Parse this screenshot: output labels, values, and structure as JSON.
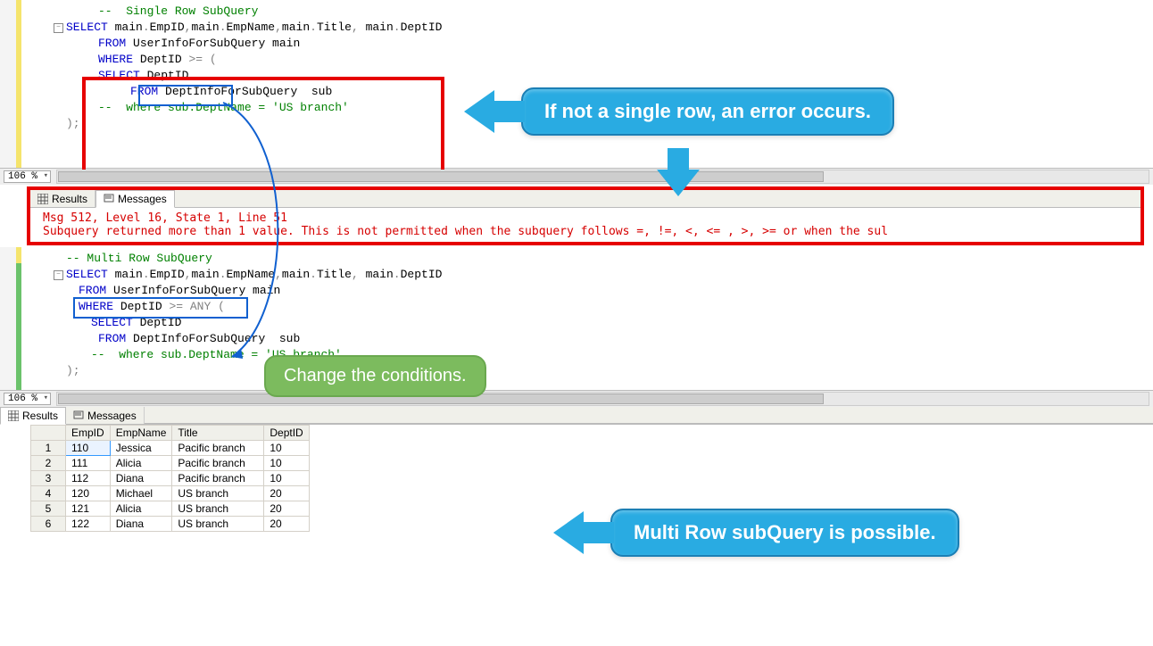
{
  "zoom": "106 %",
  "callouts": {
    "top": "If not a single row, an error occurs.",
    "mid": "Change the conditions.",
    "bottom": "Multi Row subQuery is possible."
  },
  "tabs": {
    "results": "Results",
    "messages": "Messages"
  },
  "error": {
    "line1": "Msg 512, Level 16, State 1, Line 51",
    "line2": "Subquery returned more than 1 value. This is not permitted when the subquery follows =, !=, <, <= , >, >= or when the sul"
  },
  "code1": {
    "l1_a": "-- ",
    "l1_b": " Single Row SubQuery",
    "l2_a": "SELECT",
    "l2_b": " main",
    "l2_c": ".",
    "l2_d": "EmpID",
    "l2_e": ",",
    "l2_f": "main",
    "l2_g": ".",
    "l2_h": "EmpName",
    "l2_i": ",",
    "l2_j": "main",
    "l2_k": ".",
    "l2_l": "Title",
    "l2_m": ",",
    "l2_n": " main",
    "l2_o": ".",
    "l2_p": "DeptID",
    "l3_a": "FROM",
    "l3_b": " UserInfoForSubQuery main",
    "l4_a": "WHERE",
    "l4_b": " DeptID ",
    "l4_c": ">=",
    "l4_op": " (",
    "l5_a": "SELECT",
    "l5_b": " DeptID",
    "l6_a": "FROM",
    "l6_b": " DeptInfoForSubQuery  sub",
    "l7_a": "--  where sub.DeptName = 'US branch'",
    "l8": ");"
  },
  "code2": {
    "l1": "-- Multi Row SubQuery",
    "l2_a": "SELECT",
    "l2_b": " main",
    "l2_c": ".",
    "l2_d": "EmpID",
    "l2_e": ",",
    "l2_f": "main",
    "l2_g": ".",
    "l2_h": "EmpName",
    "l2_i": ",",
    "l2_j": "main",
    "l2_k": ".",
    "l2_l": "Title",
    "l2_m": ",",
    "l2_n": " main",
    "l2_o": ".",
    "l2_p": "DeptID",
    "l3_a": "FROM",
    "l3_b": " UserInfoForSubQuery main",
    "l4_a": "WHERE",
    "l4_b": " DeptID ",
    "l4_c": ">=",
    "l4_any": " ANY ",
    "l4_op": "(",
    "l5_a": "SELECT",
    "l5_b": " DeptID",
    "l6_a": "FROM",
    "l6_b": " DeptInfoForSubQuery  sub",
    "l7_a": "--  where sub.DeptName = 'US branch'",
    "l8": ");"
  },
  "cols": [
    "",
    "EmpID",
    "EmpName",
    "Title",
    "DeptID"
  ],
  "rows": [
    {
      "n": "1",
      "EmpID": "110",
      "EmpName": "Jessica",
      "Title": "Pacific branch",
      "DeptID": "10"
    },
    {
      "n": "2",
      "EmpID": "111",
      "EmpName": "Alicia",
      "Title": "Pacific branch",
      "DeptID": "10"
    },
    {
      "n": "3",
      "EmpID": "112",
      "EmpName": "Diana",
      "Title": "Pacific branch",
      "DeptID": "10"
    },
    {
      "n": "4",
      "EmpID": "120",
      "EmpName": "Michael",
      "Title": "US branch",
      "DeptID": "20"
    },
    {
      "n": "5",
      "EmpID": "121",
      "EmpName": "Alicia",
      "Title": "US branch",
      "DeptID": "20"
    },
    {
      "n": "6",
      "EmpID": "122",
      "EmpName": "Diana",
      "Title": "US branch",
      "DeptID": "20"
    }
  ]
}
